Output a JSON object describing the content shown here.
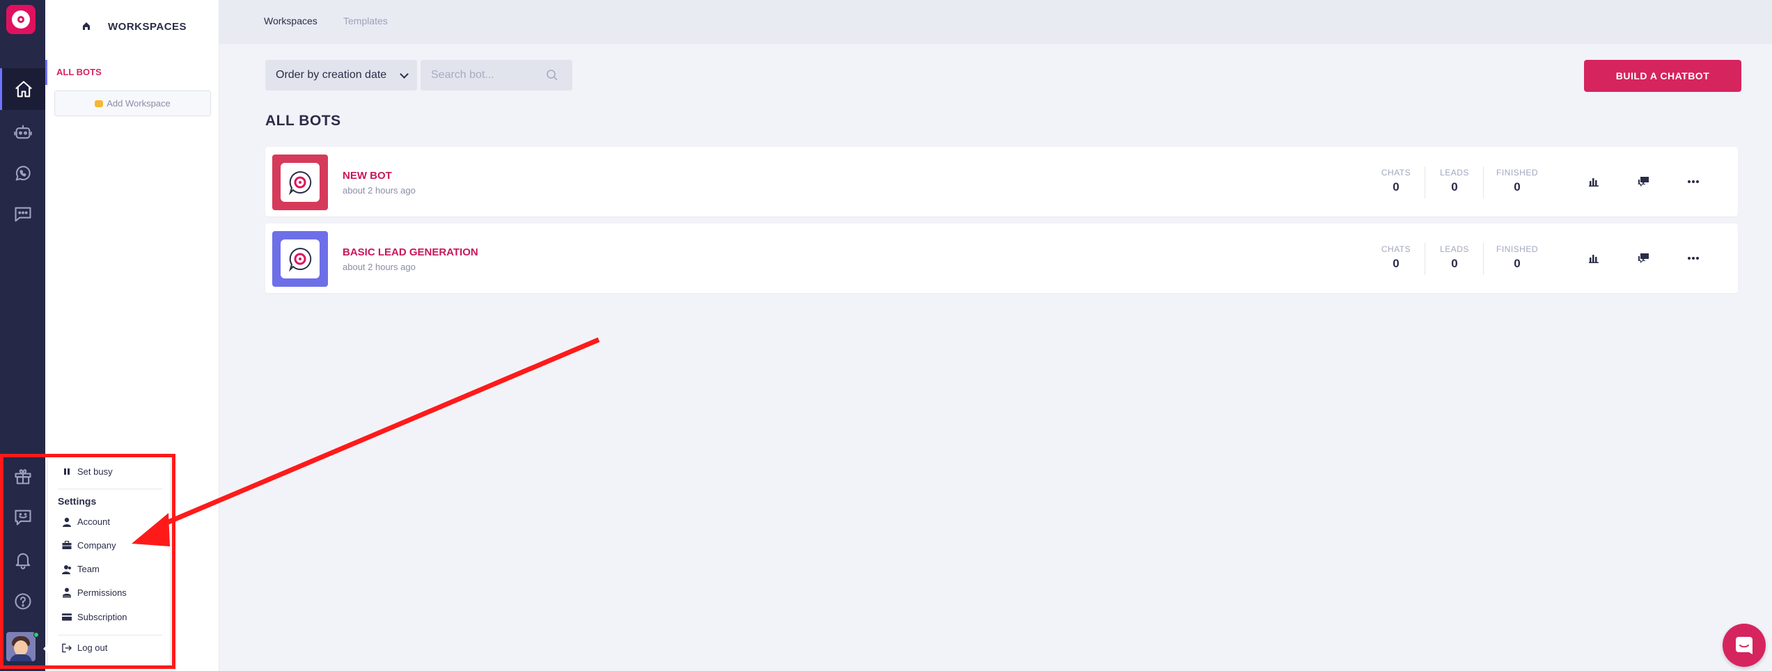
{
  "workspace_panel": {
    "title": "WORKSPACES",
    "all_bots_label": "ALL BOTS",
    "add_workspace_label": "Add Workspace"
  },
  "topnav": {
    "tabs": [
      {
        "label": "Workspaces",
        "active": true
      },
      {
        "label": "Templates",
        "active": false
      }
    ]
  },
  "controls": {
    "order_select_value": "Order by creation date",
    "search_placeholder": "Search bot...",
    "build_button_label": "BUILD A CHATBOT"
  },
  "main": {
    "section_title": "ALL BOTS",
    "bots": [
      {
        "name": "NEW BOT",
        "created": "about 2 hours ago",
        "thumb_color": "#d63a5a",
        "stats": [
          {
            "label": "CHATS",
            "value": "0"
          },
          {
            "label": "LEADS",
            "value": "0"
          },
          {
            "label": "FINISHED",
            "value": "0"
          }
        ]
      },
      {
        "name": "BASIC LEAD GENERATION",
        "created": "about 2 hours ago",
        "thumb_color": "#6d6fe8",
        "stats": [
          {
            "label": "CHATS",
            "value": "0"
          },
          {
            "label": "LEADS",
            "value": "0"
          },
          {
            "label": "FINISHED",
            "value": "0"
          }
        ]
      }
    ]
  },
  "rail": {
    "top_icons": [
      "home-icon",
      "bot-icon",
      "whatsapp-icon",
      "chat-icon"
    ],
    "bottom_icons": [
      "gift-icon",
      "feedback-icon",
      "bell-icon",
      "help-icon"
    ]
  },
  "popup_menu": {
    "set_busy_label": "Set busy",
    "settings_heading": "Settings",
    "items": [
      {
        "label": "Account",
        "icon": "user-icon"
      },
      {
        "label": "Company",
        "icon": "briefcase-icon"
      },
      {
        "label": "Team",
        "icon": "team-icon"
      },
      {
        "label": "Permissions",
        "icon": "permissions-icon"
      },
      {
        "label": "Subscription",
        "icon": "credit-card-icon"
      }
    ],
    "logout_label": "Log out"
  },
  "colors": {
    "accent": "#d6245f",
    "rail_bg": "#252846",
    "annotation_red": "#ff1a1a"
  }
}
